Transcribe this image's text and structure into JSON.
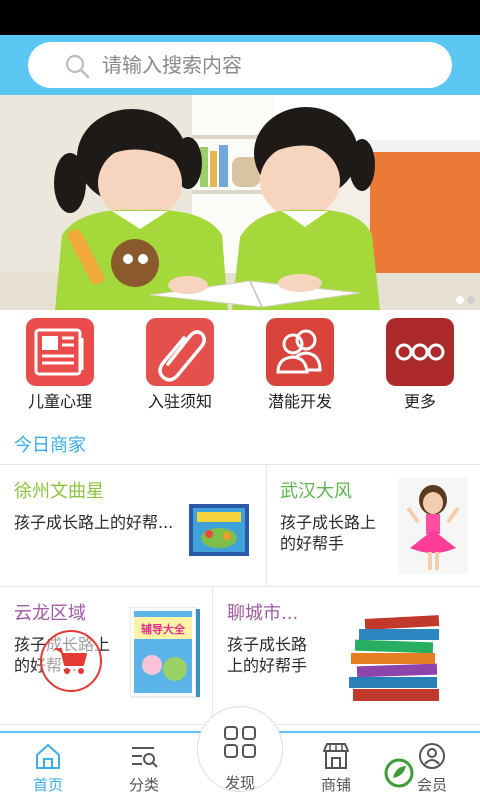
{
  "search": {
    "placeholder": "请输入搜索内容"
  },
  "banner": {
    "slide_count": 2,
    "active_slide": 0,
    "image": "two-girls-reading-photo"
  },
  "quick_links": [
    {
      "label": "儿童心理",
      "icon": "newspaper-icon",
      "color": "#e94c4a"
    },
    {
      "label": "入驻须知",
      "icon": "paperclip-icon",
      "color": "#e4504b"
    },
    {
      "label": "潜能开发",
      "icon": "people-icon",
      "color": "#d8433c"
    },
    {
      "label": "更多",
      "icon": "more-dots-icon",
      "color": "#ad2a2a"
    }
  ],
  "section": {
    "title": "今日商家"
  },
  "merchants": [
    {
      "name": "徐州文曲星",
      "desc": "孩子成长路上的好帮...",
      "name_color": "#8cc43e",
      "image": "book-image"
    },
    {
      "name": "武汉大风",
      "desc": "孩子成长路上的好帮手",
      "name_color": "#5fb34f",
      "image": "girl-image"
    },
    {
      "name": "云龙区域",
      "desc": "孩子成长路上的好帮...",
      "name_color": "#a05aa6",
      "image": "guidebook-image",
      "image_text": "辅导大全"
    },
    {
      "name": "聊城市...",
      "desc": "孩子成长路上的好帮手",
      "name_color": "#a05aa6",
      "image": "stacked-books-image"
    }
  ],
  "cart_button": {
    "icon": "cart-icon",
    "color": "#e53935"
  },
  "nav": [
    {
      "label": "首页",
      "icon": "home-icon",
      "active": true
    },
    {
      "label": "分类",
      "icon": "category-search-icon",
      "active": false
    },
    {
      "label": "发现",
      "icon": "discover-grid-icon",
      "active": false
    },
    {
      "label": "商铺",
      "icon": "shop-icon",
      "active": false
    },
    {
      "label": "会员",
      "icon": "member-icon",
      "active": false
    }
  ],
  "colors": {
    "header": "#5cc6f3",
    "accent": "#3aaee6",
    "nav_active": "#3aaee6",
    "nav_inactive": "#555555"
  }
}
